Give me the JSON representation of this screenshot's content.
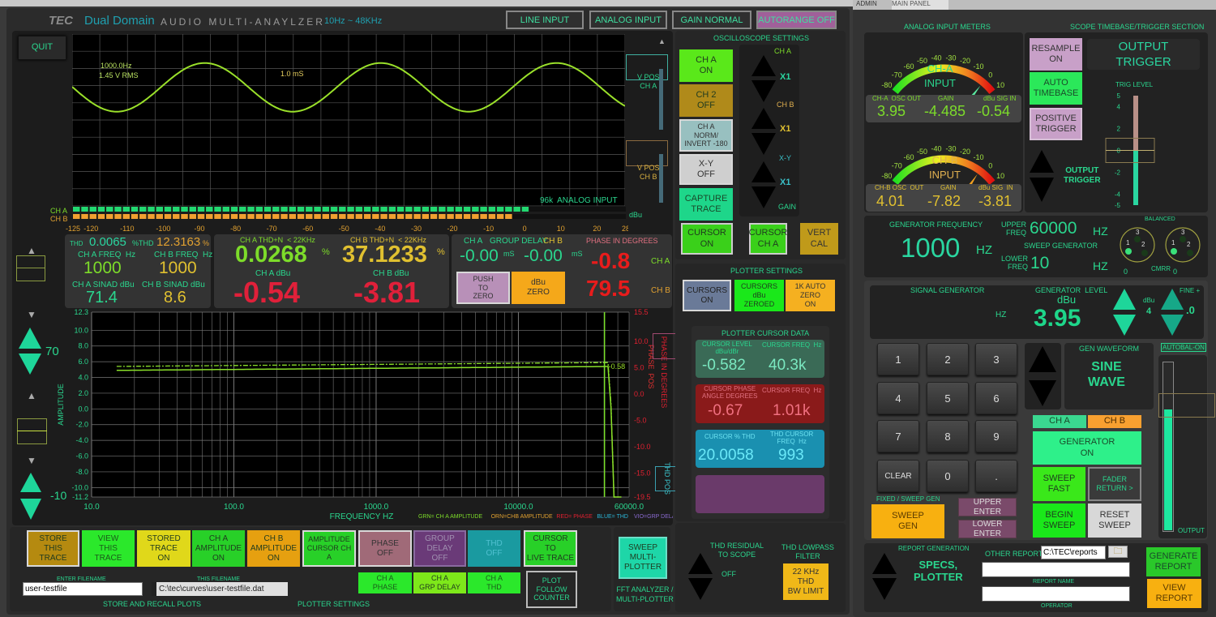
{
  "header": {
    "brand": "TEC",
    "product": "Dual Domain",
    "subtitle": "AUDIO MULTI-ANAYLZER",
    "range": "10Hz ~ 48KHz",
    "buttons": [
      "LINE INPUT",
      "ANALOG INPUT",
      "GAIN NORMAL",
      "AUTORANGE OFF"
    ],
    "right_tabs": [
      "ADMIN",
      "MAIN PANEL"
    ]
  },
  "quit_label": "QUIT",
  "scope": {
    "freq_annotation": "1000.0Hz",
    "rms_annotation": "1.45 V RMS",
    "time_annotation": "1.0 mS",
    "status": "96k  ANALOG INPUT",
    "vpos_a": "V POS\nCH A",
    "vpos_b": "V POS\nCH B"
  },
  "level_bar": {
    "label_a": "CH A",
    "label_b": "CH B",
    "unit": "dBu",
    "ticks": [
      "-125",
      "-120",
      "-110",
      "-100",
      "-90",
      "-80",
      "-70",
      "-60",
      "-50",
      "-40",
      "-30",
      "-20",
      "-10",
      "0",
      "10",
      "20",
      "28"
    ],
    "min": -125,
    "max": 28,
    "ch_a_level_dbu": -0.54,
    "ch_b_level_dbu": -3.81
  },
  "thd_panel": {
    "thd_label": "THD",
    "thd_a": "0.0065",
    "thd_mid": "%THD",
    "thd_b": "12.3163",
    "thd_unit": "%",
    "ch_a_freq_label": "CH A FREQ  Hz",
    "ch_b_freq_label": "CH B FREQ  Hz",
    "ch_a_freq": "1000",
    "ch_b_freq": "1000",
    "ch_a_sinad_label": "CH A SINAD dBu",
    "ch_b_sinad_label": "CH B SINAD dBu",
    "ch_a_sinad": "71.4",
    "ch_b_sinad": "8.6"
  },
  "thdn_panel": {
    "ch_a_label": "CH A THD+N  < 22KHz",
    "ch_b_label": "CH B THD+N  < 22KHz",
    "ch_a_value": "0.0268",
    "ch_b_value": "37.1233",
    "pct": "%",
    "ch_a_dbu_label": "CH A dBu",
    "ch_b_dbu_label": "CH B dBu",
    "ch_a_dbu": "-0.54",
    "ch_b_dbu": "-3.81"
  },
  "delay_panel": {
    "title_a": "CH A",
    "title_mid": "GROUP DELAY",
    "title_b": "CH B",
    "ch_a_delay": "-0.00",
    "ch_b_delay": "-0.00",
    "unit": "mS",
    "push_zero": "PUSH\nTO\nZERO",
    "dbu_zero": "dBu\nZERO",
    "phase_title": "PHASE IN DEGREES",
    "phase_a": "-0.8",
    "phase_b": "79.5",
    "phase_a_label": "CH A",
    "phase_b_label": "CH B"
  },
  "plotter": {
    "ylabel": "AMPLITUDE",
    "y2label": "PHASE IN DEGREES",
    "xlabel": "FREQUENCY HZ",
    "y_ticks": [
      "12.3",
      "10.0",
      "8.0",
      "6.0",
      "4.0",
      "2.0",
      "0.0",
      "-2.0",
      "-4.0",
      "-6.0",
      "-8.0",
      "-10.0",
      "-11.2"
    ],
    "y2_ticks": [
      "15.5",
      "10.0",
      "5.0",
      "0.0",
      "-5.0",
      "-10.0",
      "-15.0",
      "-19.5"
    ],
    "x_ticks": [
      "10.0",
      "100.0",
      "1000.0",
      "10000.0",
      "60000.0"
    ],
    "cursor_value": "-0.58",
    "phase_pos": "PHASE  POS",
    "thd_pos": "THD POS",
    "legend": [
      {
        "text": "GRN= CH A AMPLITUDE",
        "color": "#7ddc2a"
      },
      {
        "text": "ORN=CHB AMPLITUDE",
        "color": "#e0a030"
      },
      {
        "text": "RED= PHASE",
        "color": "#e02030"
      },
      {
        "text": "BLUE= THD",
        "color": "#2bb6d8"
      },
      {
        "text": "VIO=GRP DELAY",
        "color": "#8a6ad0"
      }
    ],
    "top_range": "70",
    "bottom_range": "-10"
  },
  "osc_settings": {
    "title": "OSCILLOSCOPE SETTINGS",
    "ch_a_on": "CH A\nON",
    "ch2_off": "CH 2\nOFF",
    "norm_invert": "CH A\nNORM/\nINVERT -180",
    "xy_off": "X-Y\nOFF",
    "capture": "CAPTURE\nTRACE",
    "gain_ch_a": "CH A",
    "gain_ch_b": "CH B",
    "gain_xy": "X-Y",
    "gain_label": "GAIN",
    "x1_a": "X1",
    "x1_b": "X1",
    "x1_xy": "X1",
    "cursor_on": "CURSOR\nON",
    "cursor_ch_a": "CURSOR\nCH A",
    "vert_cal": "VERT\nCAL"
  },
  "plotter_settings": {
    "title": "PLOTTER SETTINGS",
    "cursors_on": "CURSORS\nON",
    "cursors_zeroed": "CURSORS\ndBu\nZEROED",
    "auto_zero": "1K AUTO\nZERO\nON",
    "cursor_data_title": "PLOTTER CURSOR DATA",
    "level_label": "CURSOR LEVEL\ndBu/dBr",
    "level_freq_label": "CURSOR FREQ  Hz",
    "level_value": "-0.582",
    "level_freq": "40.3k",
    "phase_label": "CURSOR PHASE\nANGLE DEGREES",
    "phase_freq_label": "CURSOR FREQ  Hz",
    "phase_value": "-0.67",
    "phase_freq": "1.01k",
    "thd_label": "CURSOR % THD",
    "thd_freq_label": "THD CURSOR\nFREQ  Hz",
    "thd_value": "20.0058",
    "thd_freq": "993"
  },
  "bottom": {
    "store": "STORE\nTHIS\nTRACE",
    "view": "VIEW\nTHIS\nTRACE",
    "stored_on": "STORED\nTRACE\nON",
    "ch_a_amp": "CH A\nAMPLITUDE\nON",
    "ch_b_amp": "CH B\nAMPLITUDE\nON",
    "amp_cursor": "AMPLITUDE\nCURSOR CH A",
    "phase_off": "PHASE\nOFF",
    "grp_delay_off": "GROUP\nDELAY\nOFF",
    "thd_off": "THD\nOFF",
    "cursor_live": "CURSOR\nTO\nLIVE TRACE",
    "ch_a_phase": "CH A\nPHASE",
    "ch_a_grp": "CH A\nGRP DELAY",
    "ch_a_thd": "CH A\nTHD",
    "plot_follow": "PLOT\nFOLLOW\nCOUNTER",
    "enter_filename_label": "ENTER FILENAME",
    "filename_value": "user-testfile",
    "this_filename_label": "THIS FILENAME",
    "this_filename_value": "C:\\tec\\curves\\user-testfile.dat",
    "store_recall_label": "STORE AND RECALL PLOTS",
    "plotter_settings_label": "PLOTTER SETTINGS",
    "sweep_multi": "SWEEP\nMULTI-\nPLOTTER",
    "fft_label": "FFT ANALYZER /\nMULTI-PLOTTER",
    "thd_residual_label": "THD RESIDUAL\nTO SCOPE",
    "thd_residual_value": "OFF",
    "thd_lowpass_label": "THD LOWPASS\nFILTER",
    "thd_lowpass_btn": "22 KHz\nTHD\nBW LIMIT"
  },
  "meters": {
    "title": "ANALOG INPUT METERS",
    "scale": [
      "-80",
      "-70",
      "-60",
      "-50",
      "-40",
      "-30",
      "-20",
      "-10",
      "0",
      "10"
    ],
    "ch_a_name": "CH-A\nINPUT",
    "ch_b_name": "CH-B\nINPUT",
    "ch_a_level": -0.54,
    "ch_b_level": -3.81,
    "ch_a_row_labels": [
      "CH-A  OSC OUT",
      "GAIN",
      "dBu SIG IN"
    ],
    "ch_a_row_values": [
      "3.95",
      "-4.485",
      "-0.54"
    ],
    "ch_b_row_labels": [
      "CH-B OSC  OUT",
      "GAIN",
      "dBu SIG  IN"
    ],
    "ch_b_row_values": [
      "4.01",
      "-7.82",
      "-3.81"
    ]
  },
  "timebase": {
    "title": "SCOPE TIMEBASE/TRIGGER SECTION",
    "resample": "RESAMPLE\nON",
    "auto_timebase": "AUTO\nTIMEBASE",
    "positive_trigger": "POSITIVE\nTRIGGER",
    "output_trigger_display": "OUTPUT\nTRIGGER",
    "output_trigger_label": "OUTPUT\nTRIGGER",
    "trig_level_label": "TRIG LEVEL",
    "trig_ticks": [
      "5",
      "4",
      "2",
      "0",
      "-2",
      "-4",
      "-5"
    ],
    "trig_level": 0
  },
  "generator": {
    "freq_title": "GENERATOR FREQUENCY",
    "freq_value": "1000",
    "freq_unit": "HZ",
    "upper_label": "UPPER\nFREQ",
    "upper_value": "60000",
    "lower_label": "LOWER\nFREQ",
    "lower_value": "10",
    "hz": "HZ",
    "sweep_label": "SWEEP GENERATOR",
    "balanced": "BALANCED",
    "cmrr": "CMRR",
    "xlr_left_value": "0",
    "xlr_right_value": "0",
    "signal_gen_title": "SIGNAL GENERATOR",
    "sig_hz": "HZ",
    "level_title": "GENERATOR  LEVEL",
    "level_unit": "dBu",
    "level_value": "3.95",
    "step_unit": "dBu",
    "step_value": "4",
    "fine_label": "FINE +",
    "fine_value": ".0",
    "keys": [
      "1",
      "2",
      "3",
      "4",
      "5",
      "6",
      "7",
      "8",
      "9",
      "CLEAR",
      "0",
      "."
    ],
    "waveform_title": "GEN WAVEFORM",
    "waveform": "SINE\nWAVE",
    "ch_a": "CH A",
    "ch_b": "CH B",
    "gen_on": "GENERATOR\nON",
    "sweep_fast": "SWEEP\nFAST",
    "fader_return": "FADER\nRETURN >",
    "begin_sweep": "BEGIN\nSWEEP",
    "reset_sweep": "RESET\nSWEEP",
    "fixed_sweep_label": "FIXED / SWEEP GEN",
    "sweep_gen": "SWEEP\nGEN",
    "upper_enter": "UPPER ENTER",
    "lower_enter": "LOWER ENTER",
    "autobal": "AUTOBAL-ON",
    "output_label": "OUTPUT",
    "output_level": 0.72
  },
  "report": {
    "title": "REPORT GENERATION",
    "type": "SPECS,\nPLOTTER",
    "other_label": "OTHER REPORTS",
    "path": "C:\\TEC\\reports",
    "report_name_label": "REPORT NAME",
    "operator_label": "OPERATOR",
    "report_name_value": "",
    "operator_value": "",
    "generate": "GENERATE\nREPORT",
    "view": "VIEW\nREPORT"
  }
}
